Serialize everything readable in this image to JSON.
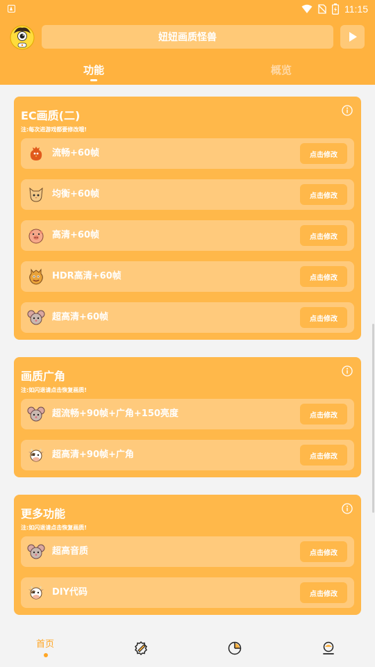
{
  "status_bar": {
    "time": "11:15"
  },
  "header": {
    "title": "妞妞画质怪兽",
    "tabs": [
      {
        "label": "功能",
        "active": true
      },
      {
        "label": "概览",
        "active": false
      }
    ]
  },
  "sections": [
    {
      "title": "EC画质(二)",
      "note": "注:每次进游戏都要修改哦!",
      "items": [
        {
          "label": "流畅+60帧",
          "icon": "chicken-icon",
          "button": "点击修改"
        },
        {
          "label": "均衡+60帧",
          "icon": "cat-icon",
          "button": "点击修改"
        },
        {
          "label": "高清+60帧",
          "icon": "pig-icon",
          "button": "点击修改"
        },
        {
          "label": "HDR高清+60帧",
          "icon": "dragon-icon",
          "button": "点击修改"
        },
        {
          "label": "超高清+60帧",
          "icon": "mouse-icon",
          "button": "点击修改"
        }
      ]
    },
    {
      "title": "画质广角",
      "note": "注:如闪退请点击恢复画质!",
      "items": [
        {
          "label": "超流畅+90帧+广角+150亮度",
          "icon": "mouse-icon",
          "button": "点击修改"
        },
        {
          "label": "超高清+90帧+广角",
          "icon": "cow-icon",
          "button": "点击修改"
        }
      ]
    },
    {
      "title": "更多功能",
      "note": "注:如闪退请点击恢复画质!",
      "items": [
        {
          "label": "超高音质",
          "icon": "mouse-icon",
          "button": "点击修改"
        },
        {
          "label": "DIY代码",
          "icon": "cow-icon",
          "button": "点击修改"
        }
      ]
    }
  ],
  "bottom_nav": {
    "home_label": "首页",
    "items": [
      "home",
      "settings-badge-icon",
      "pie-chart-icon",
      "profile-icon"
    ]
  },
  "colors": {
    "accent": "#ffb23f",
    "card": "#ffb84a",
    "row": "#ffca7c",
    "nav_active": "#ffa625"
  }
}
